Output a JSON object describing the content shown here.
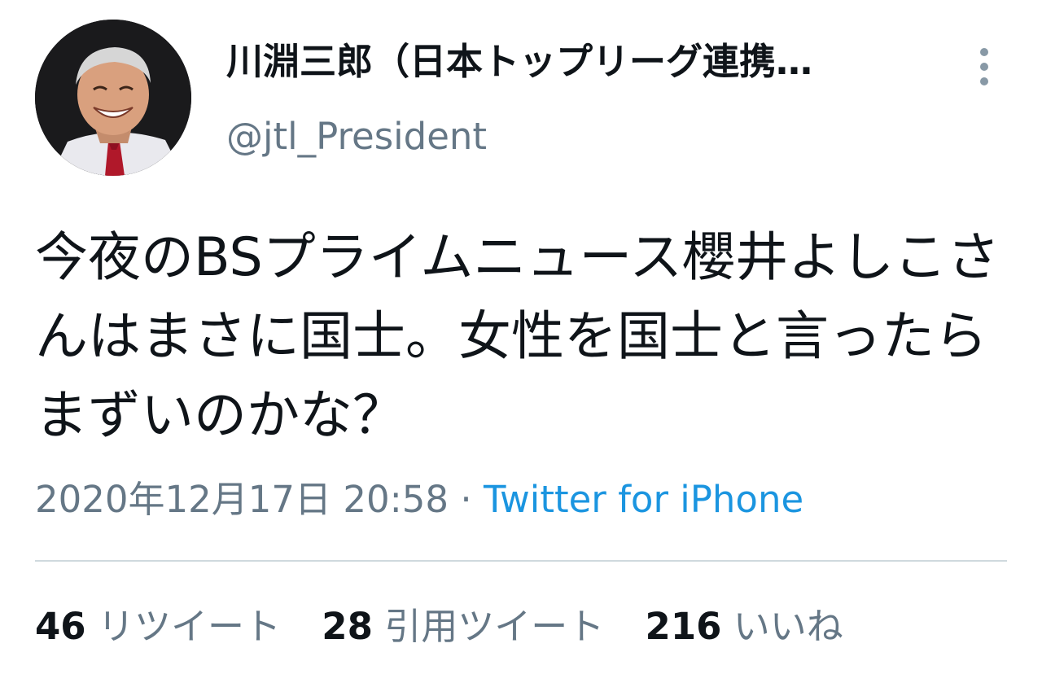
{
  "tweet": {
    "author": {
      "display_name": "川淵三郎（日本トップリーグ連携…",
      "handle": "@jtl_President"
    },
    "text": "今夜のBSプライムニュース櫻井よしこさんはまさに国士。女性を国士と言ったらまずいのかな？",
    "timestamp": "2020年12月17日 20:58",
    "separator": "·",
    "source": "Twitter for iPhone",
    "stats": {
      "retweets": {
        "count": "46",
        "label": "リツイート"
      },
      "quotes": {
        "count": "28",
        "label": "引用ツイート"
      },
      "likes": {
        "count": "216",
        "label": "いいね"
      }
    }
  },
  "icons": {
    "more": "vertical-ellipsis-icon"
  },
  "colors": {
    "text_primary": "#0f1419",
    "text_secondary": "#657786",
    "link": "#1b95e0",
    "divider": "#cfd9de"
  }
}
